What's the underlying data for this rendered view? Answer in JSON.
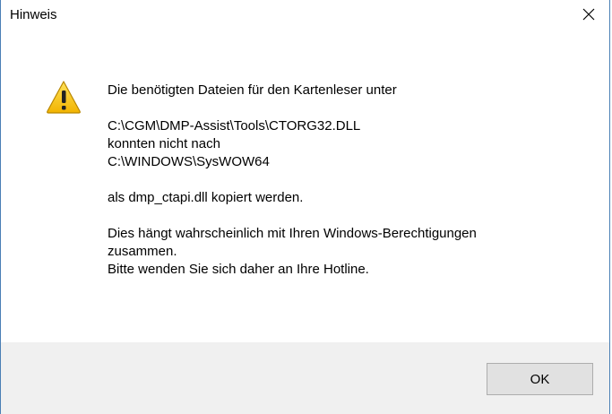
{
  "window": {
    "title": "Hinweis"
  },
  "dialog": {
    "icon": "warning-icon",
    "message": {
      "line1": "Die benötigten Dateien für den Kartenleser unter",
      "line2": "C:\\CGM\\DMP-Assist\\Tools\\CTORG32.DLL",
      "line3": "konnten nicht nach",
      "line4": "C:\\WINDOWS\\SysWOW64",
      "line5": "als dmp_ctapi.dll kopiert werden.",
      "line6": "Dies hängt wahrscheinlich mit Ihren Windows-Berechtigungen",
      "line7": "zusammen.",
      "line8": "Bitte wenden Sie sich daher an Ihre Hotline."
    }
  },
  "buttons": {
    "ok_label": "OK"
  },
  "colors": {
    "window_border": "#4a7fb5",
    "footer_bg": "#f0f0f0",
    "button_bg": "#e1e1e1",
    "button_border": "#adadad"
  }
}
